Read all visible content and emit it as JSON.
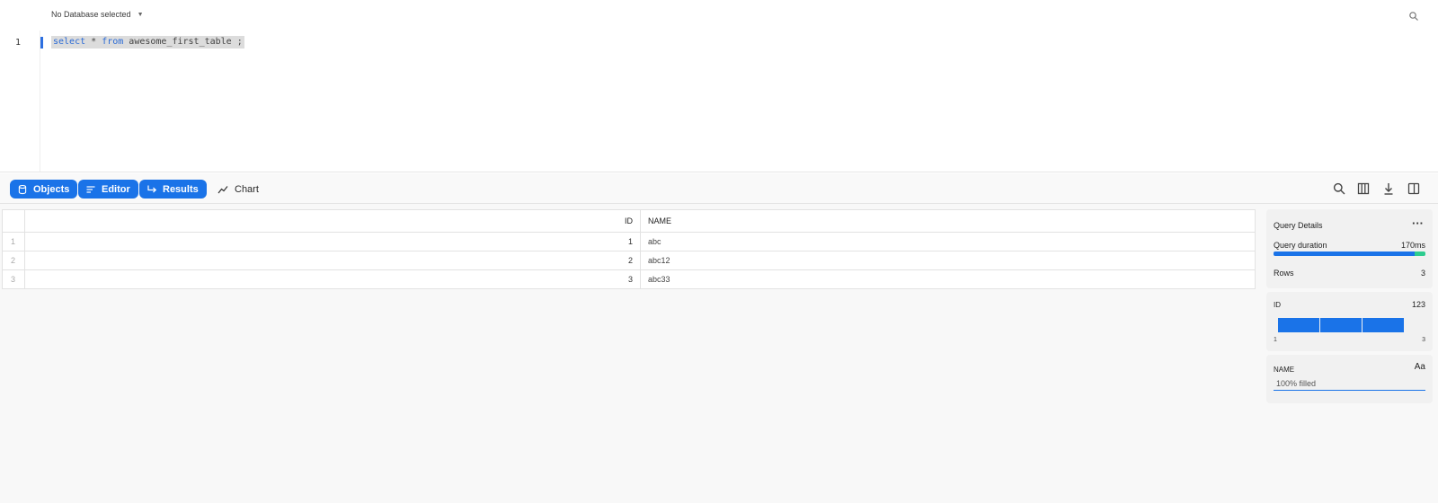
{
  "editor": {
    "database_selector": "No Database selected",
    "line_number": "1",
    "query": {
      "kw_select": "select",
      "star": " * ",
      "kw_from": "from",
      "rest": " awesome_first_table ;"
    }
  },
  "toolbar": {
    "objects_label": "Objects",
    "editor_label": "Editor",
    "results_label": "Results",
    "chart_label": "Chart"
  },
  "colors": {
    "accent": "#1a73e8",
    "success": "#2ecc8f"
  },
  "grid": {
    "columns": [
      "ID",
      "NAME"
    ],
    "rows": [
      {
        "row": "1",
        "id": "1",
        "name": "abc"
      },
      {
        "row": "2",
        "id": "2",
        "name": "abc12"
      },
      {
        "row": "3",
        "id": "3",
        "name": "abc33"
      }
    ]
  },
  "query_details": {
    "title": "Query Details",
    "duration_label": "Query duration",
    "duration_value": "170ms",
    "duration_main_fraction": 0.93,
    "rows_label": "Rows",
    "rows_value": "3"
  },
  "id_column_card": {
    "name": "ID",
    "type_label": "123",
    "histogram_bins": [
      1,
      1,
      1
    ],
    "min": "1",
    "max": "3"
  },
  "name_column_card": {
    "name": "NAME",
    "type_label": "Aa",
    "filled_text": "100% filled"
  }
}
